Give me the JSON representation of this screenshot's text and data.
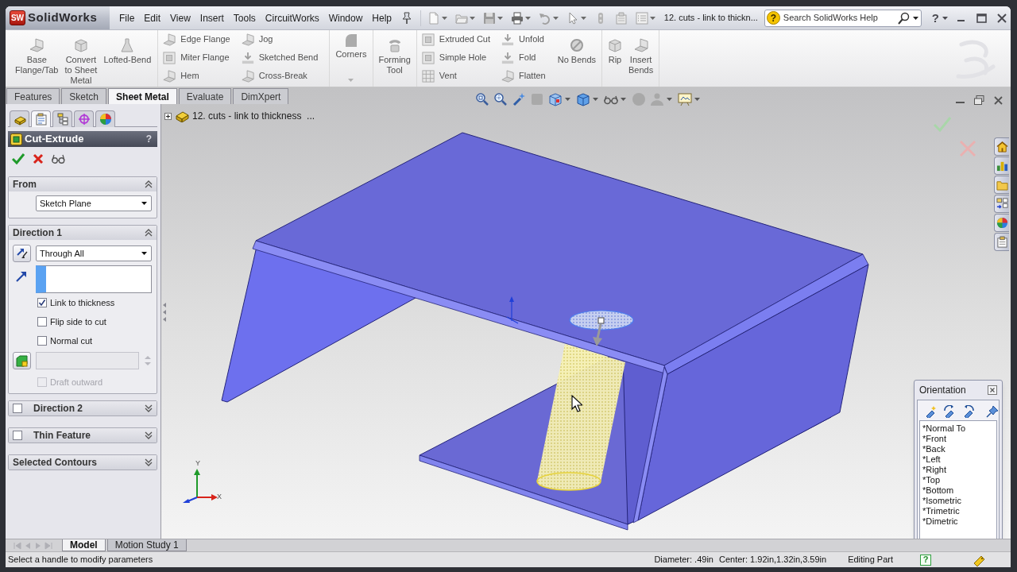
{
  "app": {
    "logo_badge": "SW",
    "logo": "SolidWorks",
    "document_title": "12. cuts - link to thickn...",
    "help_glyph": "?"
  },
  "menu": [
    "File",
    "Edit",
    "View",
    "Insert",
    "Tools",
    "CircuitWorks",
    "Window",
    "Help"
  ],
  "search": {
    "placeholder": "Search SolidWorks Help",
    "help_glyph": "?"
  },
  "command_manager": {
    "groups": [
      {
        "columns": [
          {
            "kind": "large",
            "label": "Base\nFlange/Tab"
          },
          {
            "kind": "large",
            "label": "Convert\nto Sheet\nMetal"
          },
          {
            "kind": "large",
            "label": "Lofted-Bend"
          }
        ]
      },
      {
        "columns": [
          {
            "kind": "stack",
            "items": [
              "Edge Flange",
              "Miter Flange",
              "Hem"
            ]
          },
          {
            "kind": "stack",
            "items": [
              "Jog",
              "Sketched Bend",
              "Cross-Break"
            ]
          }
        ]
      },
      {
        "columns": [
          {
            "kind": "menu",
            "label": "Corners"
          }
        ]
      },
      {
        "columns": [
          {
            "kind": "large",
            "label": "Forming\nTool"
          }
        ]
      },
      {
        "columns": [
          {
            "kind": "stack",
            "items": [
              "Extruded Cut",
              "Simple Hole",
              "Vent"
            ]
          },
          {
            "kind": "stack",
            "items": [
              "Unfold",
              "Fold",
              "Flatten"
            ]
          },
          {
            "kind": "large",
            "label": "No Bends"
          }
        ]
      },
      {
        "columns": [
          {
            "kind": "large",
            "label": "Rip"
          },
          {
            "kind": "large",
            "label": "Insert\nBends"
          }
        ]
      }
    ]
  },
  "feature_tabs": [
    {
      "label": "Features",
      "selected": false
    },
    {
      "label": "Sketch",
      "selected": false
    },
    {
      "label": "Sheet Metal",
      "selected": true
    },
    {
      "label": "Evaluate",
      "selected": false
    },
    {
      "label": "DimXpert",
      "selected": false
    }
  ],
  "property_manager": {
    "manager_tabs": [
      {
        "selected": false
      },
      {
        "selected": true
      },
      {
        "selected": false
      },
      {
        "selected": false
      },
      {
        "selected": false
      }
    ],
    "title": "Cut-Extrude",
    "help_glyph": "?",
    "groups": [
      {
        "kind": "from",
        "title": "From",
        "expanded": true,
        "start_condition": "Sketch Plane"
      },
      {
        "kind": "direction",
        "title": "Direction 1",
        "expanded": true,
        "end_condition": "Through All",
        "options": [
          {
            "label": "Link to thickness",
            "checked": true,
            "disabled": false
          },
          {
            "label": "Flip side to cut",
            "checked": false,
            "disabled": false
          },
          {
            "label": "Normal cut",
            "checked": false,
            "disabled": false
          }
        ],
        "draft_angle": {
          "disabled": true
        },
        "draft_outward": {
          "label": "Draft outward",
          "checked": false,
          "disabled": true
        }
      },
      {
        "kind": "optional",
        "title": "Direction 2",
        "expanded": false,
        "checked": false
      },
      {
        "kind": "optional",
        "title": "Thin Feature",
        "expanded": false,
        "checked": false
      },
      {
        "kind": "plain",
        "title": "Selected Contours",
        "expanded": false
      }
    ]
  },
  "feature_tree": {
    "expanded": false,
    "label": "12. cuts - link to thickness  ..."
  },
  "triad": {
    "labels": [
      "Y",
      "X"
    ]
  },
  "orientation": {
    "title": "Orientation",
    "views": [
      "*Normal To",
      "*Front",
      "*Back",
      "*Left",
      "*Right",
      "*Top",
      "*Bottom",
      "*Isometric",
      "*Trimetric",
      "*Dimetric"
    ]
  },
  "bottom_tabs": [
    {
      "label": "Model",
      "selected": true
    },
    {
      "label": "Motion Study 1",
      "selected": false
    }
  ],
  "status_bar": {
    "message": "Select a handle to modify parameters",
    "diameter": "Diameter: .49in",
    "center": "Center: 1.92in,1.32in,3.59in",
    "mode": "Editing Part",
    "help_glyph": "?"
  }
}
